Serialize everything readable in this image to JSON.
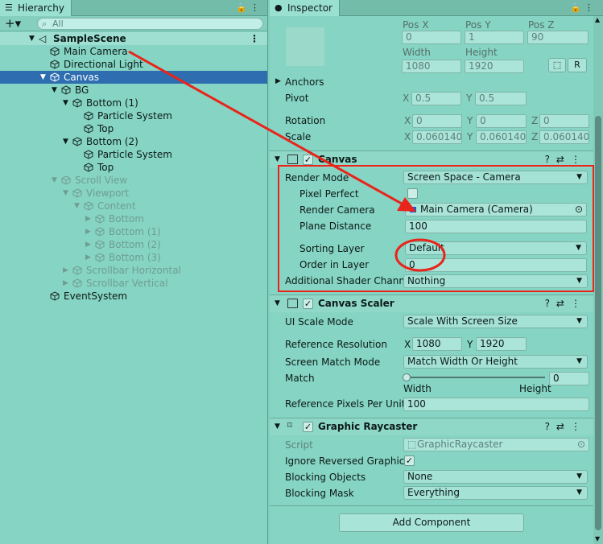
{
  "hierarchy": {
    "tab_label": "Hierarchy",
    "search_placeholder": "All",
    "scene": "SampleScene",
    "items": [
      {
        "label": "Main Camera"
      },
      {
        "label": "Directional Light"
      },
      {
        "label": "Canvas"
      },
      {
        "label": "BG"
      },
      {
        "label": "Bottom (1)"
      },
      {
        "label": "Particle System"
      },
      {
        "label": "Top"
      },
      {
        "label": "Bottom (2)"
      },
      {
        "label": "Particle System"
      },
      {
        "label": "Top"
      },
      {
        "label": "Scroll View"
      },
      {
        "label": "Viewport"
      },
      {
        "label": "Content"
      },
      {
        "label": "Bottom"
      },
      {
        "label": "Bottom (1)"
      },
      {
        "label": "Bottom (2)"
      },
      {
        "label": "Bottom (3)"
      },
      {
        "label": "Scrollbar Horizontal"
      },
      {
        "label": "Scrollbar Vertical"
      },
      {
        "label": "EventSystem"
      }
    ]
  },
  "inspector": {
    "tab_label": "Inspector",
    "rect": {
      "pos_x_label": "Pos X",
      "pos_y_label": "Pos Y",
      "pos_z_label": "Pos Z",
      "pos_x": "0",
      "pos_y": "1",
      "pos_z": "90",
      "width_label": "Width",
      "height_label": "Height",
      "width": "1080",
      "height": "1920",
      "r_button": "R",
      "anchors": "Anchors",
      "pivot": "Pivot",
      "pivot_x": "0.5",
      "pivot_y": "0.5",
      "rotation": "Rotation",
      "rot_x": "0",
      "rot_y": "0",
      "rot_z": "0",
      "scale": "Scale",
      "scale_x": "0.060140",
      "scale_y": "0.060140",
      "scale_z": "0.060140",
      "x": "X",
      "y": "Y",
      "z": "Z"
    },
    "canvas": {
      "title": "Canvas",
      "render_mode_label": "Render Mode",
      "render_mode": "Screen Space - Camera",
      "pixel_perfect_label": "Pixel Perfect",
      "render_camera_label": "Render Camera",
      "render_camera": "Main Camera (Camera)",
      "plane_distance_label": "Plane Distance",
      "plane_distance": "100",
      "sorting_layer_label": "Sorting Layer",
      "sorting_layer": "Default",
      "order_label": "Order in Layer",
      "order": "0",
      "shader_label": "Additional Shader Channe",
      "shader": "Nothing"
    },
    "scaler": {
      "title": "Canvas Scaler",
      "ui_scale_label": "UI Scale Mode",
      "ui_scale": "Scale With Screen Size",
      "ref_res_label": "Reference Resolution",
      "ref_x": "1080",
      "ref_y": "1920",
      "match_mode_label": "Screen Match Mode",
      "match_mode": "Match Width Or Height",
      "match_label": "Match",
      "match_value": "0",
      "width_label": "Width",
      "height_label": "Height",
      "ppu_label": "Reference Pixels Per Unit",
      "ppu": "100"
    },
    "raycaster": {
      "title": "Graphic Raycaster",
      "script_label": "Script",
      "script": "GraphicRaycaster",
      "ignore_label": "Ignore Reversed Graphics",
      "blocking_objects_label": "Blocking Objects",
      "blocking_objects": "None",
      "blocking_mask_label": "Blocking Mask",
      "blocking_mask": "Everything"
    },
    "add_component": "Add Component"
  },
  "colors": {
    "annotation": "#e8241b",
    "selection": "#2e6db0"
  }
}
